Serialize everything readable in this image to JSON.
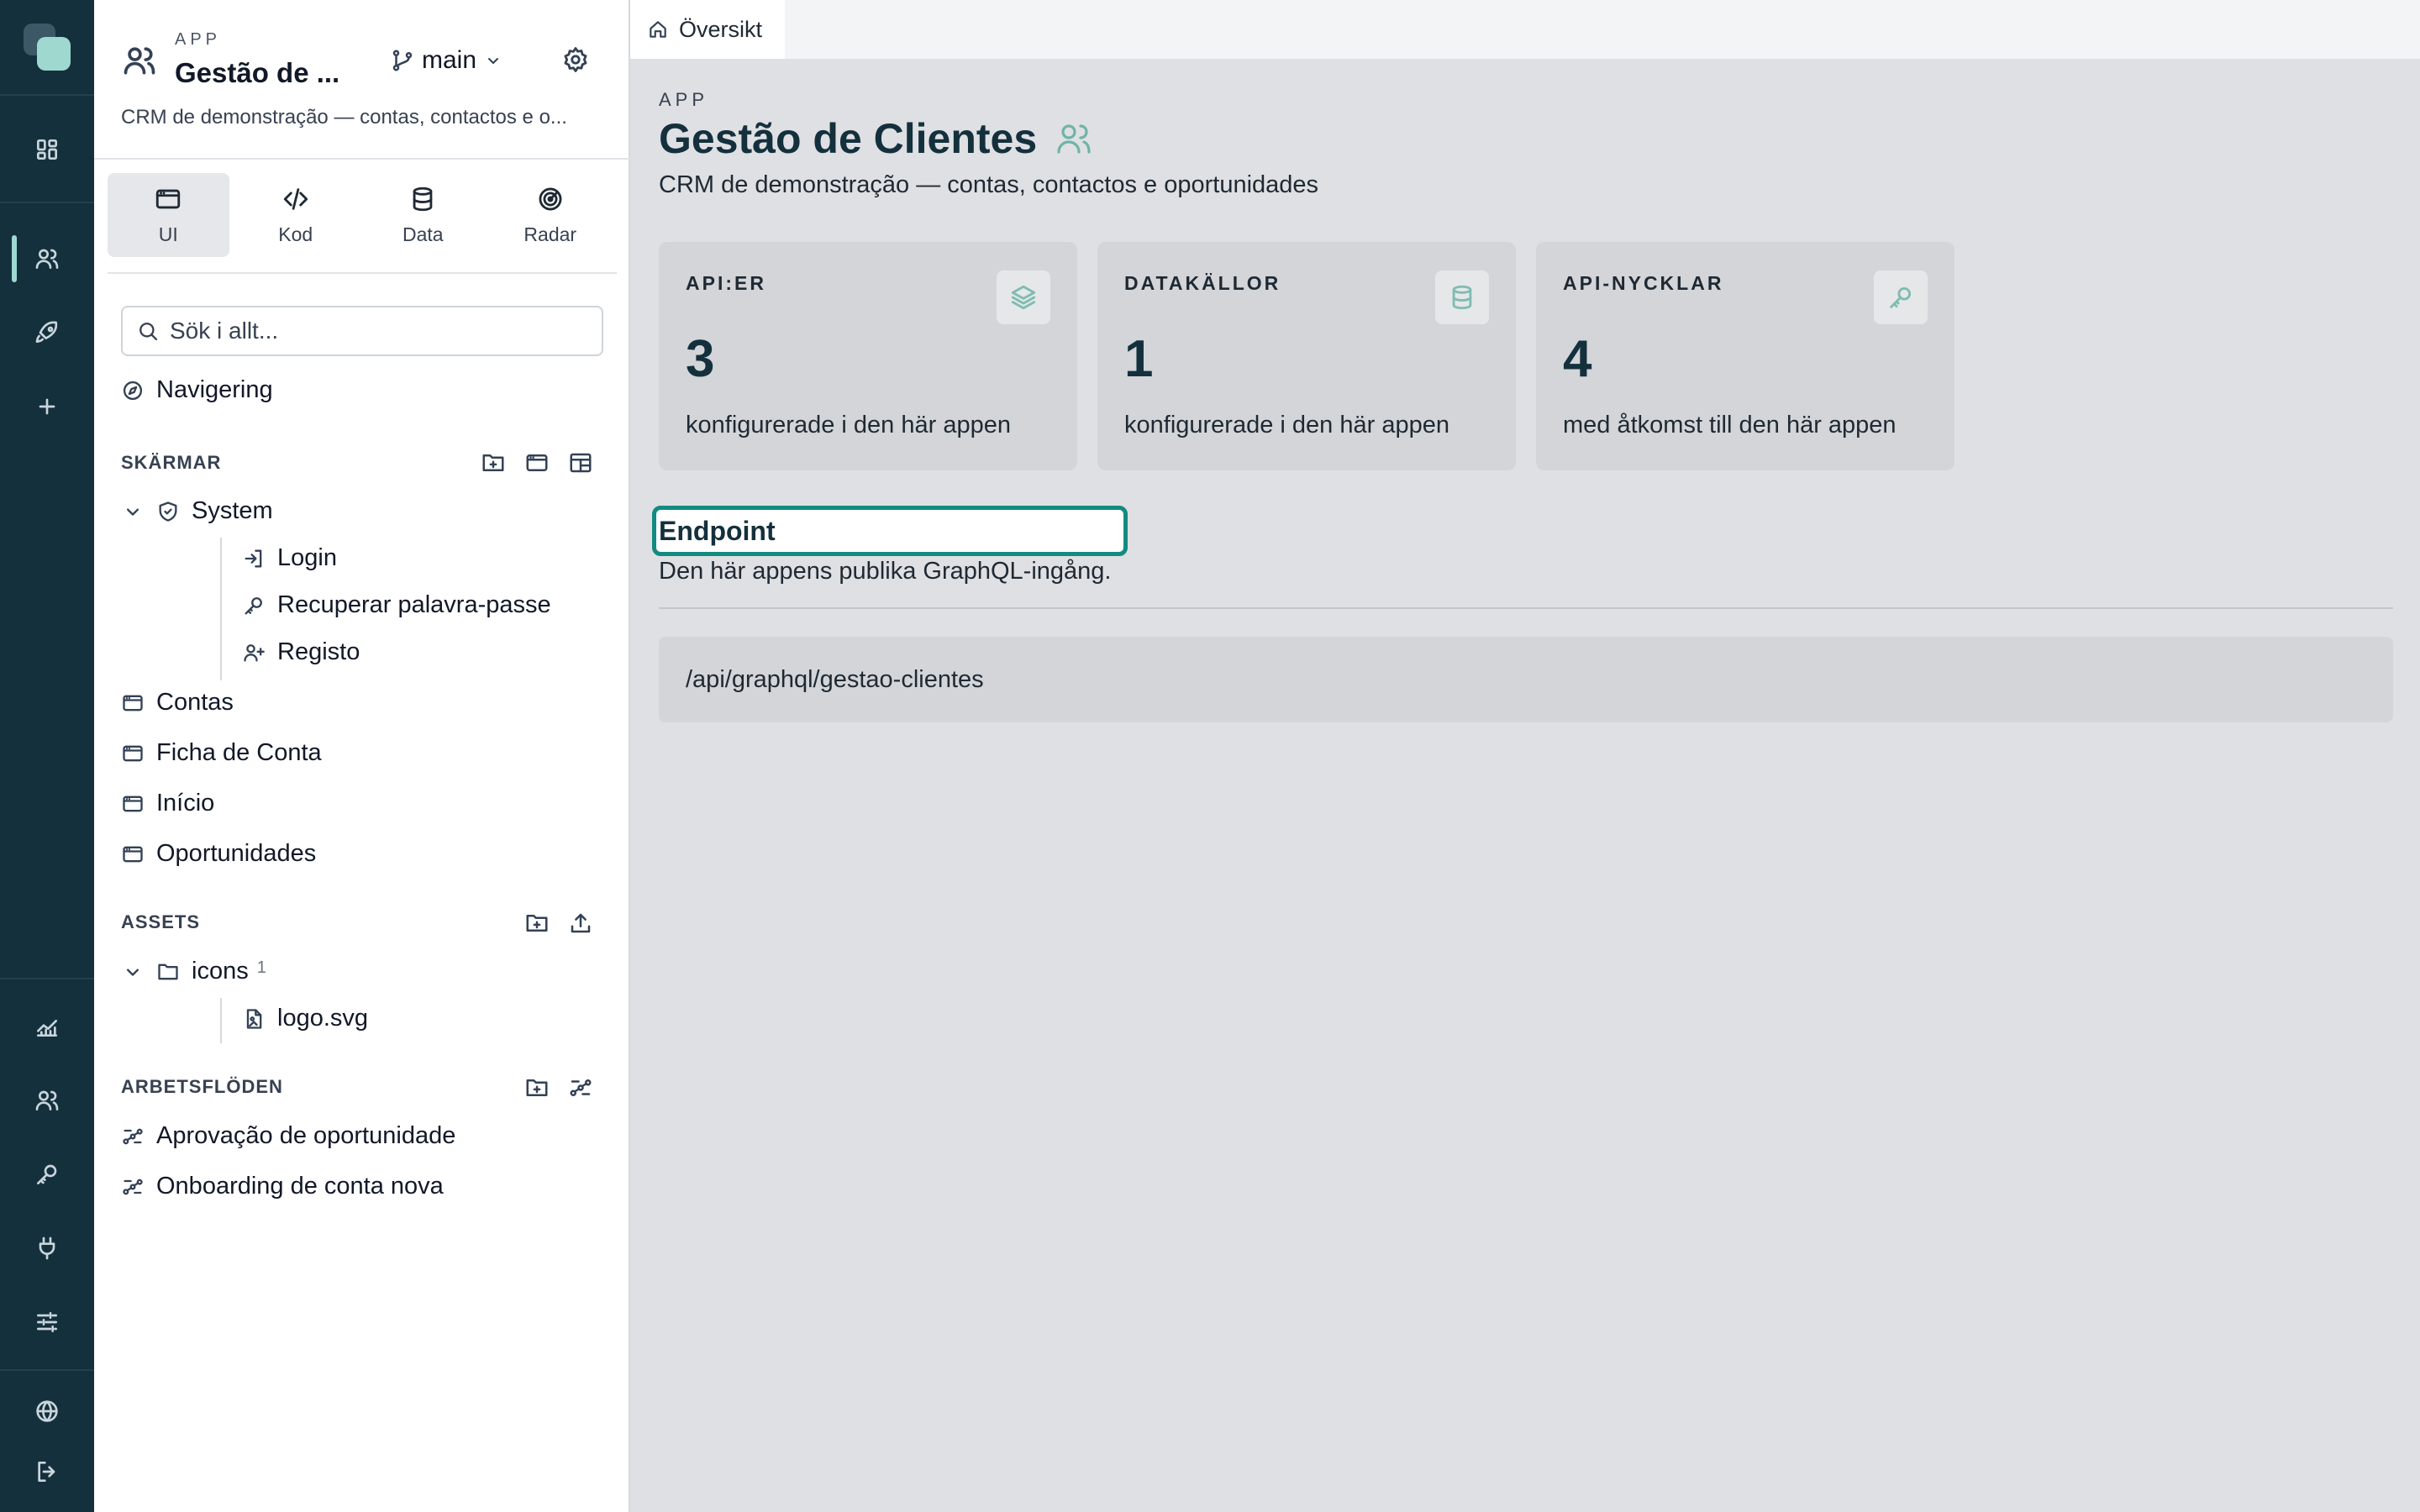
{
  "rail": {
    "icons": [
      "dashboard-icon",
      "users-icon",
      "rocket-icon",
      "plus-icon",
      "chart-icon",
      "team-icon",
      "key-icon",
      "plug-icon",
      "sliders-icon",
      "globe-icon",
      "logout-icon"
    ]
  },
  "sidebar": {
    "app_kicker": "APP",
    "app_title": "Gestão de ...",
    "branch": "main",
    "app_description": "CRM de demonstração — contas, contactos e o...",
    "tabs": [
      {
        "label": "UI",
        "icon": "window-icon"
      },
      {
        "label": "Kod",
        "icon": "code-icon"
      },
      {
        "label": "Data",
        "icon": "database-icon"
      },
      {
        "label": "Radar",
        "icon": "radar-icon"
      }
    ],
    "search_placeholder": "Sök i allt...",
    "navigation_label": "Navigering",
    "screens_header": "SKÄRMAR",
    "system_folder": "System",
    "system_children": [
      "Login",
      "Recuperar palavra-passe",
      "Registo"
    ],
    "screens": [
      "Contas",
      "Ficha de Conta",
      "Início",
      "Oportunidades"
    ],
    "assets_header": "ASSETS",
    "assets_folder": "icons",
    "assets_folder_count": "1",
    "assets_files": [
      "logo.svg"
    ],
    "workflows_header": "ARBETSFLÖDEN",
    "workflows": [
      "Aprovação de oportunidade",
      "Onboarding de conta nova"
    ]
  },
  "main": {
    "tab_label": "Översikt",
    "kicker": "APP",
    "title": "Gestão de Clientes",
    "description": "CRM de demonstração — contas, contactos e oportunidades",
    "stats": [
      {
        "label": "API:ER",
        "value": "3",
        "sub": "konfigurerade i den här appen",
        "icon": "layers-icon"
      },
      {
        "label": "DATAKÄLLOR",
        "value": "1",
        "sub": "konfigurerade i den här appen",
        "icon": "database-icon"
      },
      {
        "label": "API-NYCKLAR",
        "value": "4",
        "sub": "med åtkomst till den här appen",
        "icon": "key-icon"
      }
    ],
    "endpoint_title": "Endpoint",
    "endpoint_description": "Den här appens publika GraphQL-ingång.",
    "endpoint_url": "/api/graphql/gestao-clientes"
  },
  "colors": {
    "rail_bg": "#14303d",
    "accent": "#9fd8cf",
    "focus_ring": "#138b80",
    "title_text": "#14303d"
  }
}
